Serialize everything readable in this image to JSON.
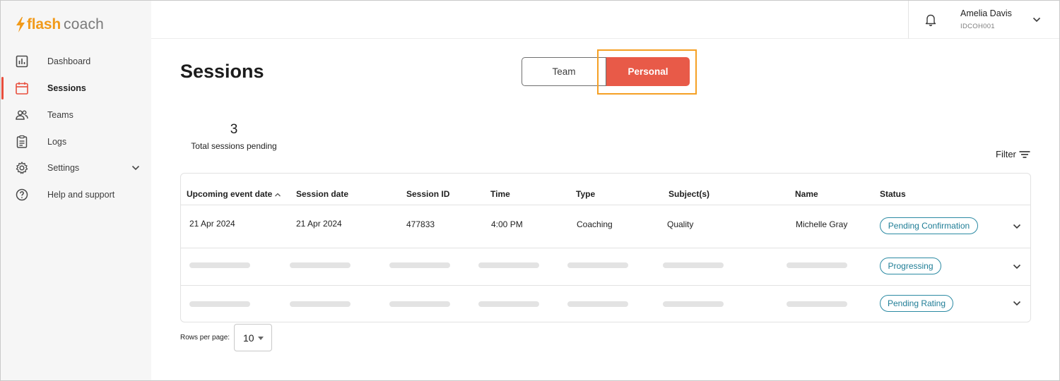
{
  "brand": {
    "word1": "flash",
    "word2": "coach"
  },
  "sidebar": {
    "items": [
      {
        "label": "Dashboard",
        "icon": "chart-icon"
      },
      {
        "label": "Sessions",
        "icon": "calendar-icon"
      },
      {
        "label": "Teams",
        "icon": "people-icon"
      },
      {
        "label": "Logs",
        "icon": "clipboard-icon"
      },
      {
        "label": "Settings",
        "icon": "gear-icon"
      },
      {
        "label": "Help and support",
        "icon": "help-icon"
      }
    ],
    "active": "Sessions"
  },
  "header": {
    "user_name": "Amelia Davis",
    "user_id": "IDCOH001"
  },
  "page": {
    "title": "Sessions"
  },
  "toggle": {
    "team": "Team",
    "personal": "Personal",
    "selected": "Personal"
  },
  "stats": {
    "count": "3",
    "label": "Total sessions pending"
  },
  "filter": {
    "label": "Filter"
  },
  "table": {
    "columns": [
      "Upcoming event date",
      "Session date",
      "Session ID",
      "Time",
      "Type",
      "Subject(s)",
      "Name",
      "Status"
    ],
    "rows": [
      {
        "upcoming": "21 Apr 2024",
        "session_date": "21 Apr 2024",
        "session_id": "477833",
        "time": "4:00 PM",
        "type": "Coaching",
        "subject": "Quality",
        "name": "Michelle Gray",
        "status": "Pending Confirmation"
      },
      {
        "status": "Progressing"
      },
      {
        "status": "Pending Rating"
      }
    ]
  },
  "pagination": {
    "rows_per_page_label": "Rows per page:",
    "rows_per_page": "10"
  },
  "colors": {
    "accent": "#e85a48",
    "brand": "#f19a1a",
    "highlight": "#f5a024",
    "badge": "#2b8aa3"
  }
}
